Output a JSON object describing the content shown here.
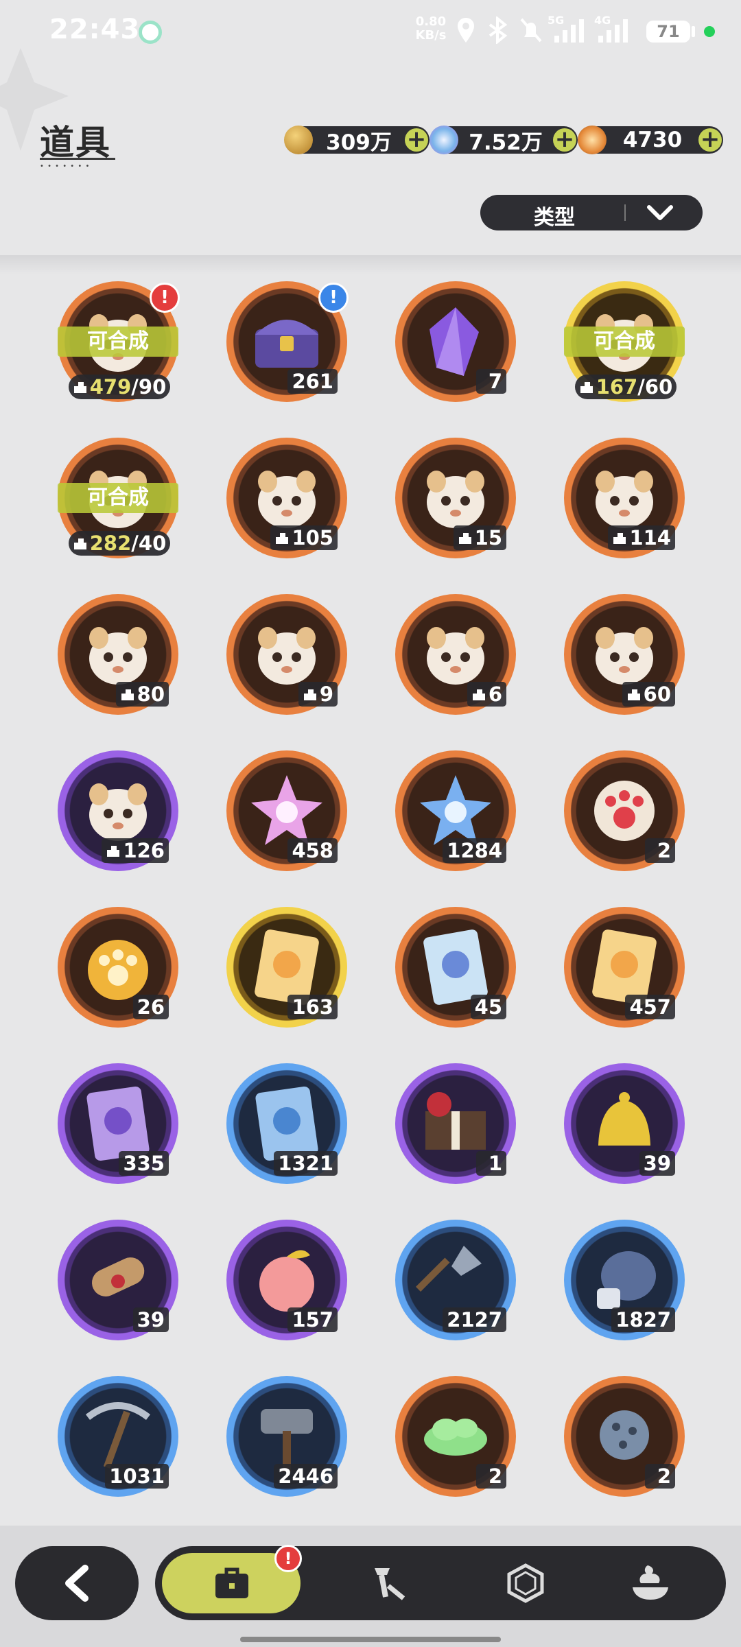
{
  "status_bar": {
    "time": "22:43",
    "net_speed_value": "0.80",
    "net_speed_unit": "KB/s",
    "sig1": "5G",
    "sig2": "4G",
    "battery": "71"
  },
  "header": {
    "title": "道具",
    "currencies": [
      {
        "icon": "gold-coin-icon",
        "value": "309万",
        "color": "#d9a441"
      },
      {
        "icon": "crystal-star-icon",
        "value": "7.52万",
        "color": "#8ec3f0"
      },
      {
        "icon": "orange-gem-icon",
        "value": "4730",
        "color": "#e58a3a"
      }
    ],
    "add_symbol": "+",
    "filter_label": "类型"
  },
  "items": [
    {
      "name": "golden-puppy-fragment",
      "frame": "orange",
      "art": "creature",
      "synth": true,
      "have": "479",
      "need": "/90",
      "badge": "!",
      "badge_color": "red"
    },
    {
      "name": "treasure-chest",
      "frame": "orange",
      "art": "chest",
      "count": "261",
      "badge": "!",
      "badge_color": "blue"
    },
    {
      "name": "purple-crystal",
      "frame": "orange",
      "art": "crystal",
      "count": "7"
    },
    {
      "name": "golden-puppy-fragment-2",
      "frame": "gold",
      "art": "creature",
      "synth": true,
      "have": "167",
      "need": "/60"
    },
    {
      "name": "golden-puppy-fragment-3",
      "frame": "orange",
      "art": "creature",
      "synth": true,
      "have": "282",
      "need": "/40"
    },
    {
      "name": "fox-fragment",
      "frame": "orange",
      "art": "creature",
      "frag": true,
      "count": "105"
    },
    {
      "name": "bear-fragment",
      "frame": "orange",
      "art": "creature",
      "frag": true,
      "count": "15"
    },
    {
      "name": "knight-fragment",
      "frame": "orange",
      "art": "creature",
      "frag": true,
      "count": "114"
    },
    {
      "name": "white-cat-fragment",
      "frame": "orange",
      "art": "creature",
      "frag": true,
      "count": "80"
    },
    {
      "name": "cream-cat-fragment",
      "frame": "orange",
      "art": "creature",
      "frag": true,
      "count": "9"
    },
    {
      "name": "brown-bear-fragment",
      "frame": "orange",
      "art": "creature",
      "frag": true,
      "count": "6"
    },
    {
      "name": "purple-cat-fragment",
      "frame": "orange",
      "art": "creature",
      "frag": true,
      "count": "60"
    },
    {
      "name": "tanuki-fragment",
      "frame": "purple",
      "art": "creature",
      "frag": true,
      "count": "126"
    },
    {
      "name": "pink-star-crystal",
      "frame": "orange",
      "art": "star-pink",
      "count": "458"
    },
    {
      "name": "blue-star-crystal",
      "frame": "orange",
      "art": "star-blue",
      "count": "1284"
    },
    {
      "name": "red-paw-charm",
      "frame": "orange",
      "art": "paw-red",
      "count": "2"
    },
    {
      "name": "gold-paw-charm",
      "frame": "orange",
      "art": "paw-gold",
      "count": "26"
    },
    {
      "name": "gold-card",
      "frame": "gold",
      "art": "card-gold",
      "count": "163"
    },
    {
      "name": "rainbow-card",
      "frame": "orange",
      "art": "card-rainbow",
      "count": "45"
    },
    {
      "name": "amber-card",
      "frame": "orange",
      "art": "card-gold",
      "count": "457"
    },
    {
      "name": "purple-card",
      "frame": "purple",
      "art": "card-purple",
      "count": "335"
    },
    {
      "name": "blue-card",
      "frame": "blue",
      "art": "card-blue",
      "count": "1321"
    },
    {
      "name": "gift-box",
      "frame": "purple",
      "art": "gift",
      "count": "1"
    },
    {
      "name": "golden-bell",
      "frame": "purple",
      "art": "bell",
      "count": "39"
    },
    {
      "name": "scroll",
      "frame": "purple",
      "art": "scroll",
      "count": "39"
    },
    {
      "name": "peach",
      "frame": "purple",
      "art": "peach",
      "count": "157"
    },
    {
      "name": "shovel",
      "frame": "blue",
      "art": "shovel",
      "count": "2127"
    },
    {
      "name": "boxing-glove",
      "frame": "blue",
      "art": "glove",
      "count": "1827"
    },
    {
      "name": "pickaxe",
      "frame": "blue",
      "art": "pickaxe",
      "count": "1031"
    },
    {
      "name": "hammer",
      "frame": "blue",
      "art": "hammer",
      "count": "2446"
    },
    {
      "name": "green-cloud",
      "frame": "orange",
      "art": "cloud",
      "count": "2"
    },
    {
      "name": "spiked-ball",
      "frame": "orange",
      "art": "mace",
      "count": "2"
    }
  ],
  "synth_label": "可合成",
  "bottom_nav": {
    "back": "chevron-left-icon",
    "tabs": [
      "bag-icon",
      "tool-icon",
      "hexagon-icon",
      "dessert-icon"
    ],
    "badge": "!"
  }
}
